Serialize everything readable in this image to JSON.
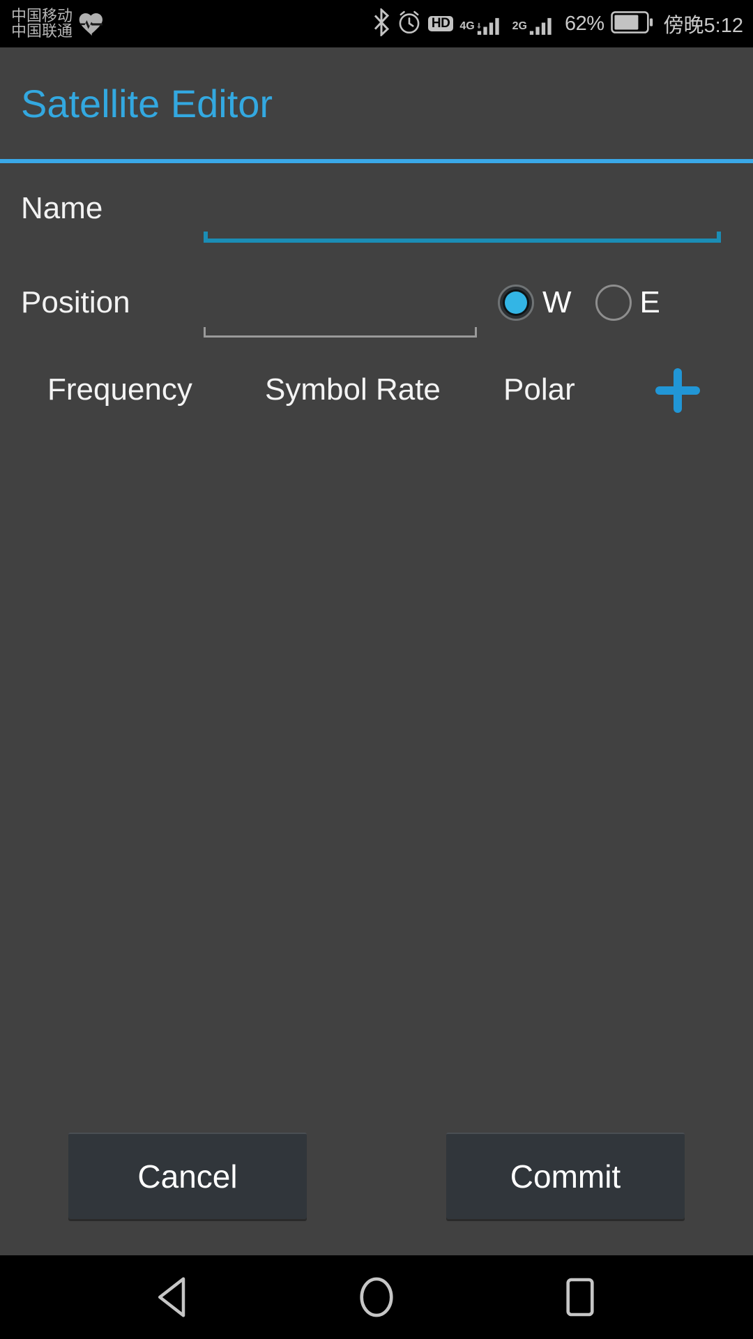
{
  "status_bar": {
    "carrier_line1": "中国移动",
    "carrier_line2": "中国联通",
    "health_icon": "heart-pulse-icon",
    "bluetooth_icon": "bluetooth-icon",
    "alarm_icon": "alarm-clock-icon",
    "hd_label": "HD",
    "sim1_network": "4G",
    "sim2_network": "2G",
    "battery_percent": "62%",
    "clock": "傍晚5:12"
  },
  "header": {
    "title": "Satellite Editor",
    "accent_color": "#33a8e0",
    "divider_color": "#3aa8e8"
  },
  "form": {
    "name": {
      "label": "Name",
      "value": "",
      "placeholder": "",
      "focused": true,
      "underline_color": "#1b8db5"
    },
    "position": {
      "label": "Position",
      "value": "",
      "placeholder": "",
      "focused": false,
      "underline_color": "#9a9a9a"
    },
    "hemisphere": {
      "selected": "W",
      "options": [
        {
          "value": "W",
          "label": "W",
          "selected": true
        },
        {
          "value": "E",
          "label": "E",
          "selected": false
        }
      ]
    }
  },
  "transponder_table": {
    "columns": [
      "Frequency",
      "Symbol Rate",
      "Polar"
    ],
    "add_icon": "plus-icon",
    "add_color": "#2196d6",
    "rows": []
  },
  "actions": {
    "cancel_label": "Cancel",
    "commit_label": "Commit"
  },
  "nav_bar": {
    "back_icon": "back-triangle-icon",
    "home_icon": "home-circle-icon",
    "recents_icon": "recents-square-icon"
  },
  "colors": {
    "background": "#414141",
    "status_bar_bg": "#000000",
    "button_bg": "#31363b",
    "accent": "#33a8e0",
    "radio_on": "#33b5e5"
  }
}
